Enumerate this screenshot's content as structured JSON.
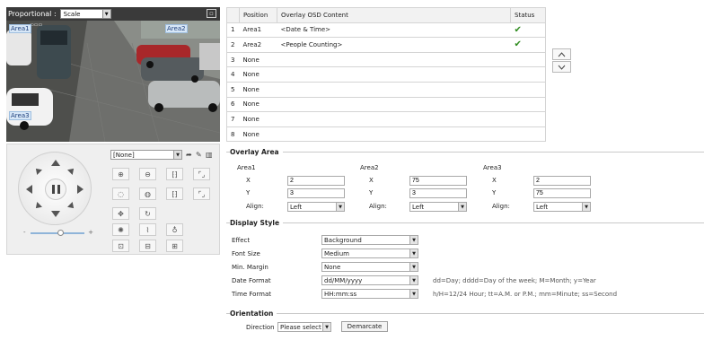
{
  "video": {
    "mode_label": "Proportional :",
    "mode_value": "Scale",
    "area_tags": [
      "Area1",
      "Area2",
      "Area3"
    ]
  },
  "ptz": {
    "preset_value": "[None]"
  },
  "osd_table": {
    "headers": [
      "",
      "Position",
      "Overlay OSD Content",
      "Status"
    ],
    "rows": [
      {
        "num": "1",
        "position": "Area1",
        "content": "<Date & Time>",
        "status": "✔"
      },
      {
        "num": "2",
        "position": "Area2",
        "content": "<People Counting>",
        "status": "✔"
      },
      {
        "num": "3",
        "position": "None",
        "content": "",
        "status": ""
      },
      {
        "num": "4",
        "position": "None",
        "content": "",
        "status": ""
      },
      {
        "num": "5",
        "position": "None",
        "content": "",
        "status": ""
      },
      {
        "num": "6",
        "position": "None",
        "content": "",
        "status": ""
      },
      {
        "num": "7",
        "position": "None",
        "content": "",
        "status": ""
      },
      {
        "num": "8",
        "position": "None",
        "content": "",
        "status": ""
      }
    ]
  },
  "overlay_area": {
    "title": "Overlay Area",
    "x_label": "X",
    "y_label": "Y",
    "align_label": "Align:",
    "areas": [
      {
        "name": "Area1",
        "x": "2",
        "y": "3",
        "align": "Left"
      },
      {
        "name": "Area2",
        "x": "75",
        "y": "3",
        "align": "Left"
      },
      {
        "name": "Area3",
        "x": "2",
        "y": "75",
        "align": "Left"
      }
    ]
  },
  "display_style": {
    "title": "Display Style",
    "effect_label": "Effect",
    "effect_value": "Background",
    "font_size_label": "Font Size",
    "font_size_value": "Medium",
    "min_margin_label": "Min. Margin",
    "min_margin_value": "None",
    "date_format_label": "Date Format",
    "date_format_value": "dd/MM/yyyy",
    "date_format_hint": "dd=Day; dddd=Day of the week; M=Month; y=Year",
    "time_format_label": "Time Format",
    "time_format_value": "HH:mm:ss",
    "time_format_hint": "h/H=12/24 Hour; tt=A.M. or P.M.; mm=Minute; ss=Second"
  },
  "orientation": {
    "title": "Orientation",
    "direction_label": "Direction",
    "direction_value": "Please select",
    "demarcate_label": "Demarcate"
  },
  "colors": {
    "status_check": "#2e8b1e",
    "area_tag_bg": "#d7e7f7",
    "video_header": "#3a3a3a"
  }
}
